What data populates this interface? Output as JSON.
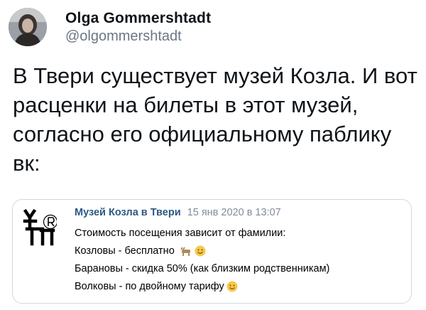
{
  "tweet": {
    "display_name": "Olga Gommershtadt",
    "handle": "@olgommershtadt",
    "text": "В Твери существует музей Козла. И вот расценки на билеты в этот музей, согласно его официальному паблику вк:"
  },
  "quoted_post": {
    "author": "Музей Козла в Твери",
    "date": "15 янв 2020 в 13:07",
    "lines": [
      "Стоимость посещения зависит от фамилии:",
      "Козловы - бесплатно",
      "Барановы - скидка 50% (как близким родственникам)",
      "Волковы - по двойному тарифу"
    ],
    "icons": [
      "goat-icon",
      "smile-icon"
    ]
  }
}
